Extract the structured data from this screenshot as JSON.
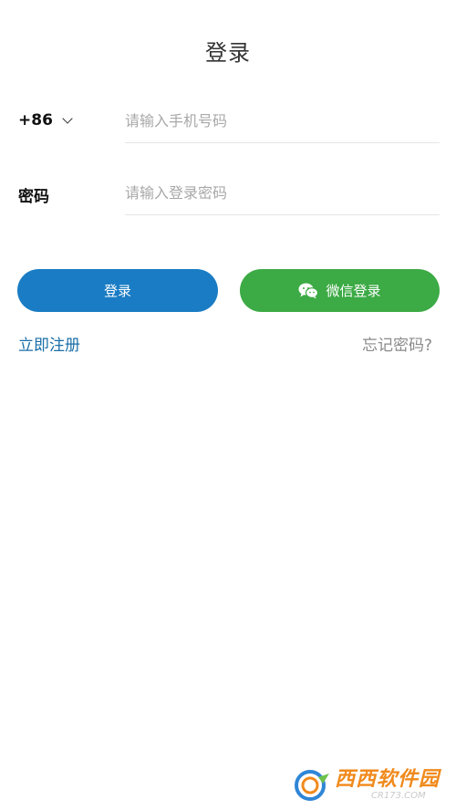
{
  "header": {
    "title": "登录"
  },
  "form": {
    "country_code": "+86",
    "phone_placeholder": "请输入手机号码",
    "phone_value": "",
    "password_label": "密码",
    "password_placeholder": "请输入登录密码",
    "password_value": ""
  },
  "buttons": {
    "login_label": "登录",
    "wechat_login_label": "微信登录"
  },
  "links": {
    "register": "立即注册",
    "forgot_password": "忘记密码?"
  },
  "watermark": {
    "main": "西西软件园",
    "sub": "CR173.COM"
  },
  "colors": {
    "primary": "#1a7cc4",
    "wechat": "#3caa45",
    "link": "#1a6ea8",
    "muted": "#8a8a8a"
  },
  "icons": {
    "country_dropdown": "chevron-down-icon",
    "wechat": "wechat-icon",
    "watermark_logo": "watermark-logo"
  }
}
